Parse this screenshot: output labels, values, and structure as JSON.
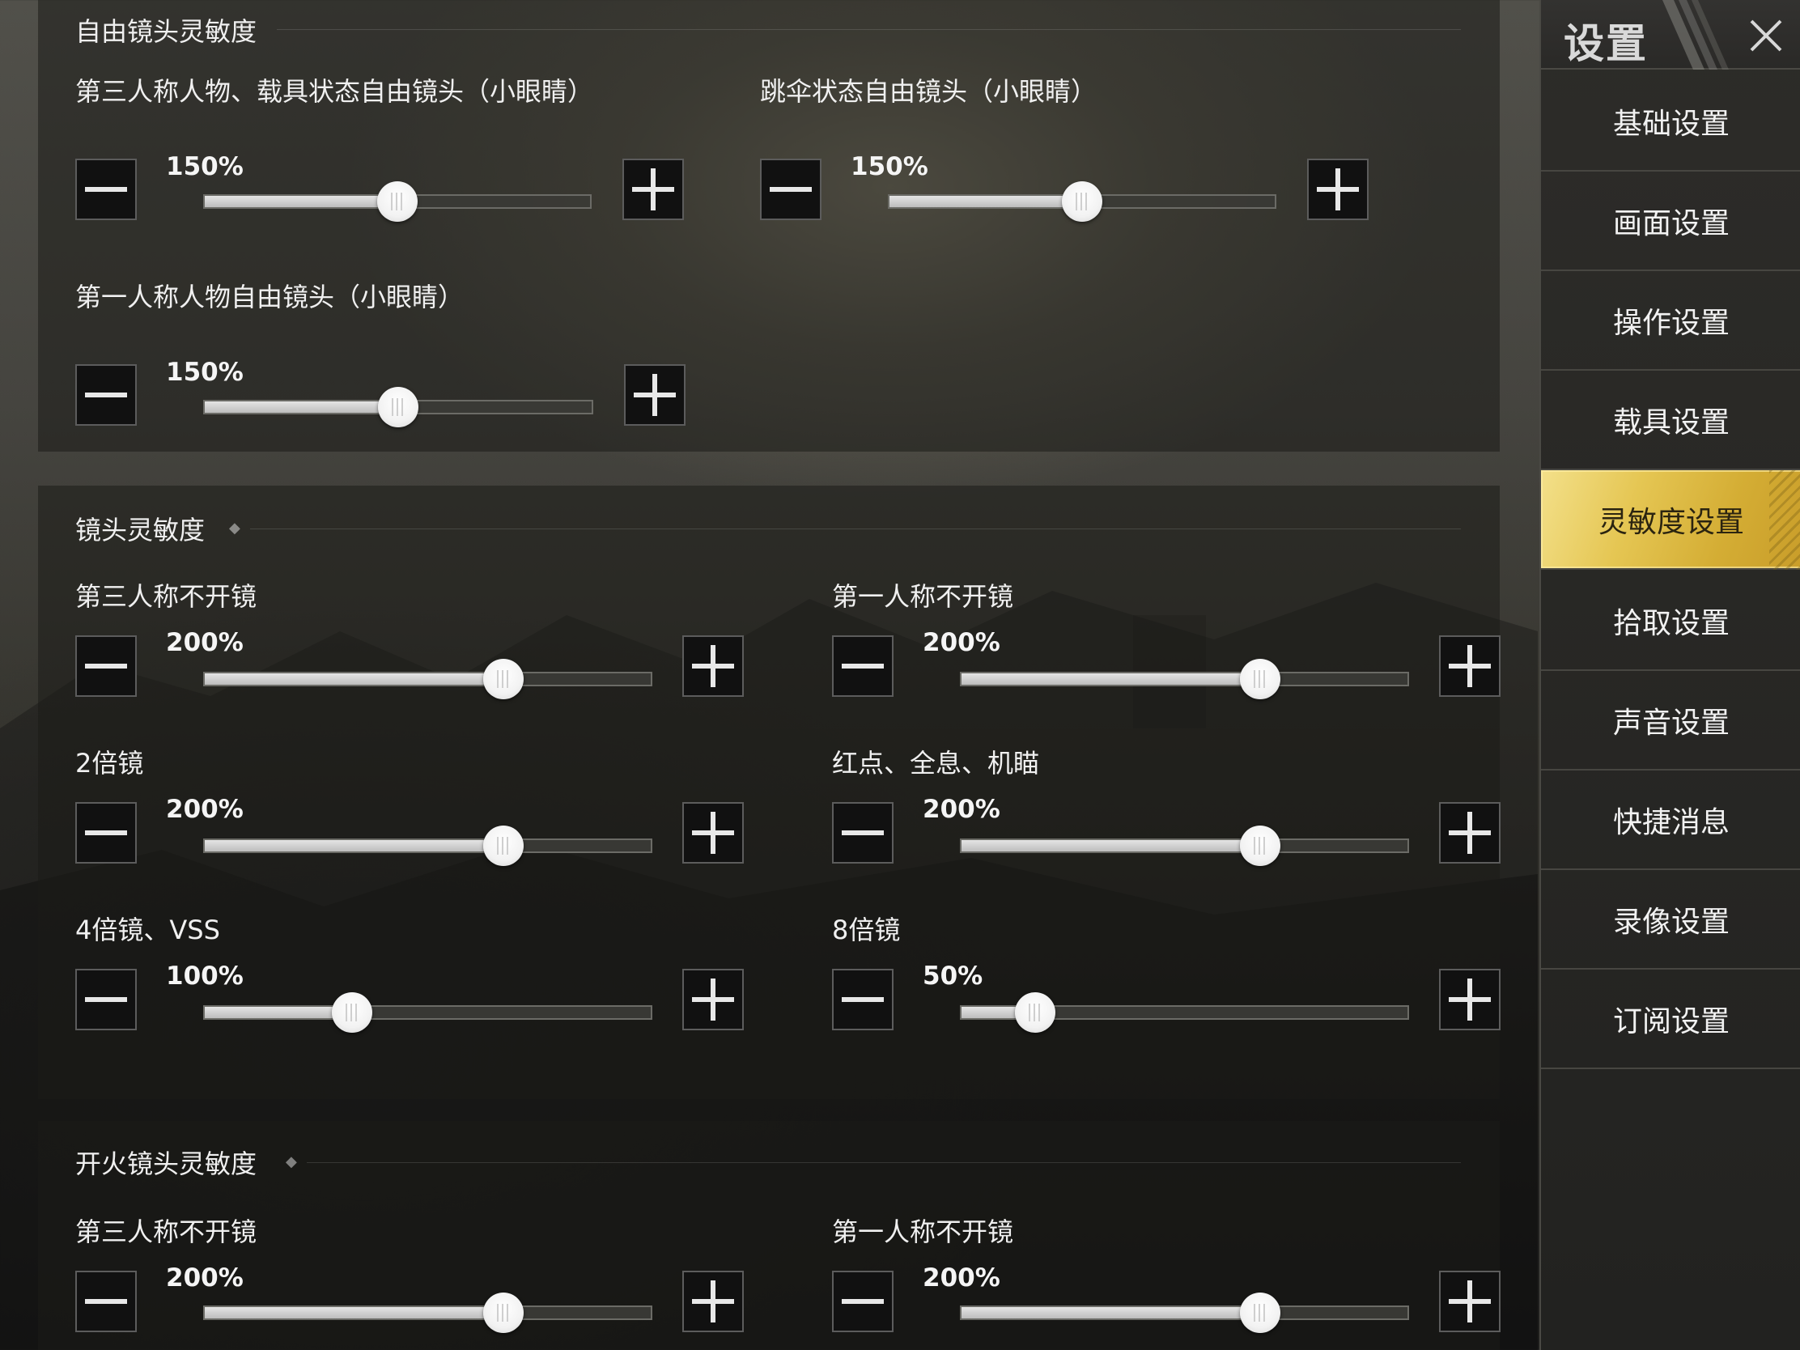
{
  "sidebar": {
    "title": "设置",
    "items": [
      {
        "label": "基础设置",
        "active": false
      },
      {
        "label": "画面设置",
        "active": false
      },
      {
        "label": "操作设置",
        "active": false
      },
      {
        "label": "载具设置",
        "active": false
      },
      {
        "label": "灵敏度设置",
        "active": true
      },
      {
        "label": "拾取设置",
        "active": false
      },
      {
        "label": "声音设置",
        "active": false
      },
      {
        "label": "快捷消息",
        "active": false
      },
      {
        "label": "录像设置",
        "active": false
      },
      {
        "label": "订阅设置",
        "active": false
      }
    ]
  },
  "sections": {
    "free_look": {
      "title": "自由镜头灵敏度",
      "settings": [
        {
          "label": "第三人称人物、载具状态自由镜头（小眼睛）",
          "value_text": "150%",
          "level": 0.5
        },
        {
          "label": "跳伞状态自由镜头（小眼睛）",
          "value_text": "150%",
          "level": 0.5
        },
        {
          "label": "第一人称人物自由镜头（小眼睛）",
          "value_text": "150%",
          "level": 0.5
        }
      ]
    },
    "camera": {
      "title": "镜头灵敏度",
      "settings": [
        {
          "label": "第三人称不开镜",
          "value_text": "200%",
          "level": 0.67
        },
        {
          "label": "第一人称不开镜",
          "value_text": "200%",
          "level": 0.67
        },
        {
          "label": "2倍镜",
          "value_text": "200%",
          "level": 0.67
        },
        {
          "label": "红点、全息、机瞄",
          "value_text": "200%",
          "level": 0.67
        },
        {
          "label": "4倍镜、VSS",
          "value_text": "100%",
          "level": 0.33
        },
        {
          "label": "8倍镜",
          "value_text": "50%",
          "level": 0.165
        }
      ]
    },
    "fire_camera": {
      "title": "开火镜头灵敏度",
      "settings": [
        {
          "label": "第三人称不开镜",
          "value_text": "200%",
          "level": 0.67
        },
        {
          "label": "第一人称不开镜",
          "value_text": "200%",
          "level": 0.67
        }
      ]
    }
  }
}
